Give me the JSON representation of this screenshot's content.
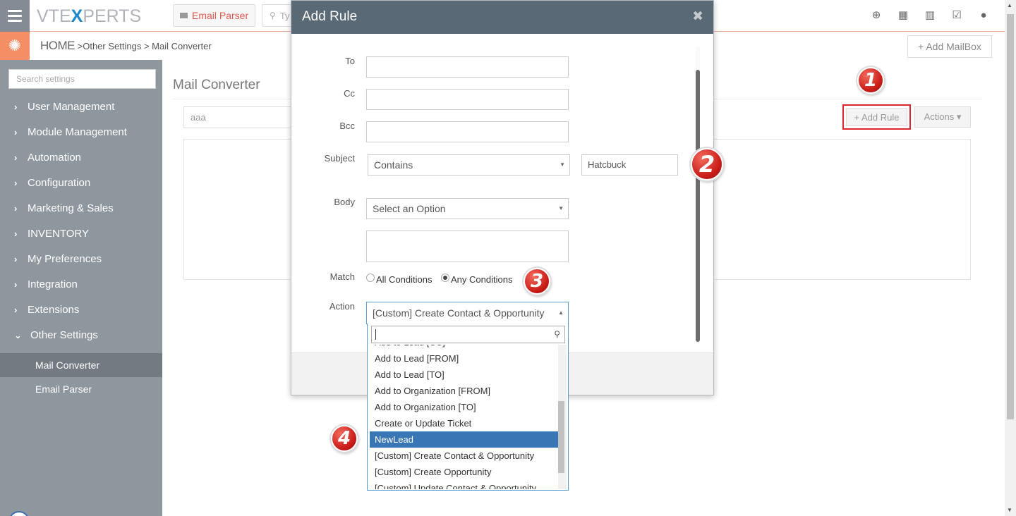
{
  "header": {
    "logo_part1": "VTE",
    "logo_part2": "X",
    "logo_part3": "PERTS",
    "module_tab": "Email Parser",
    "search_placeholder": "Ty"
  },
  "breadcrumb": {
    "home": "HOME",
    "sep1": " >",
    "level1": "Other Settings",
    "sep2": " > ",
    "level2": "Mail Converter"
  },
  "toolbar": {
    "add_mailbox": "+ Add MailBox"
  },
  "sidebar": {
    "search_placeholder": "Search settings",
    "items": [
      {
        "label": "User Management"
      },
      {
        "label": "Module Management"
      },
      {
        "label": "Automation"
      },
      {
        "label": "Configuration"
      },
      {
        "label": "Marketing & Sales"
      },
      {
        "label": "INVENTORY"
      },
      {
        "label": "My Preferences"
      },
      {
        "label": "Integration"
      },
      {
        "label": "Extensions"
      },
      {
        "label": "Other Settings"
      }
    ],
    "subitems": [
      {
        "label": "Mail Converter"
      },
      {
        "label": "Email Parser"
      }
    ]
  },
  "main": {
    "title": "Mail Converter",
    "mailbox_value": "aaa",
    "add_rule": "+ Add Rule",
    "actions": "Actions ▾"
  },
  "modal": {
    "title": "Add Rule",
    "close": "✖",
    "labels": {
      "to": "To",
      "cc": "Cc",
      "bcc": "Bcc",
      "subject": "Subject",
      "body": "Body",
      "match": "Match",
      "action": "Action"
    },
    "subject_condition": "Contains",
    "subject_value": "Hatcbuck",
    "body_condition": "Select an Option",
    "match_options": [
      "All Conditions",
      "Any Conditions"
    ],
    "match_selected": "Any Conditions",
    "action_selected": "[Custom] Create Contact & Opportunity"
  },
  "dropdown": {
    "partial_top": "Add to Lead [CC]",
    "options": [
      "Add to Lead [FROM]",
      "Add to Lead [TO]",
      "Add to Organization [FROM]",
      "Add to Organization [TO]",
      "Create or Update Ticket",
      "NewLead",
      "[Custom] Create Contact & Opportunity",
      "[Custom] Create Opportunity",
      "[Custom] Update Contact & Opportunity"
    ],
    "highlighted": "NewLead"
  },
  "callouts": [
    "1",
    "2",
    "3",
    "4"
  ],
  "colors": {
    "accent": "#f58d65",
    "sidebar": "#8e969e",
    "modal_header": "#596a76",
    "highlight": "#3876b5",
    "callout_red": "#c91b17",
    "module_tab_text": "#e3594c"
  }
}
